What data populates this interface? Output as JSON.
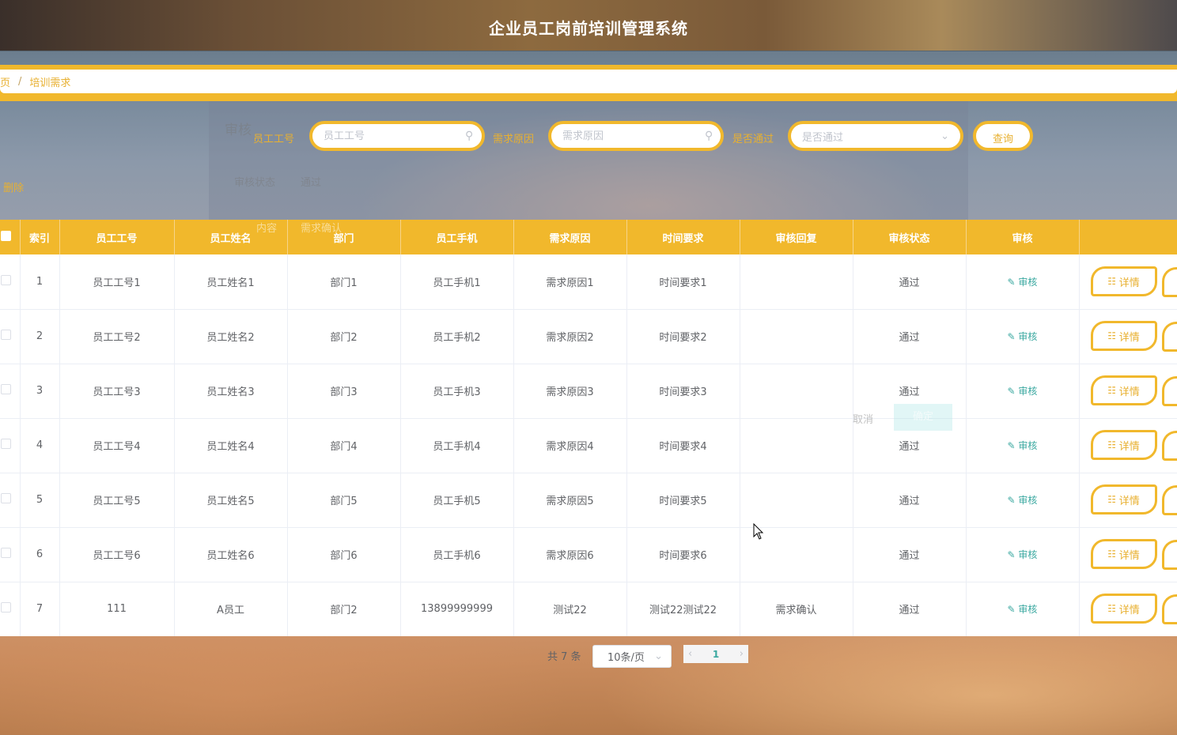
{
  "app": {
    "title": "企业员工岗前培训管理系统"
  },
  "breadcrumb": {
    "home": "页",
    "separator": "/",
    "current": "培训需求"
  },
  "ghost_dialog": {
    "title": "审核",
    "status_label": "审核状态",
    "status_value": "通过",
    "content_label": "内容",
    "content_value": "需求确认",
    "cancel": "取消",
    "confirm": "确定"
  },
  "search": {
    "employee_id_label": "员工工号",
    "employee_id_placeholder": "员工工号",
    "reason_label": "需求原因",
    "reason_placeholder": "需求原因",
    "passed_label": "是否通过",
    "passed_placeholder": "是否通过",
    "query_button": "查询"
  },
  "toolbar": {
    "delete_label": "删除"
  },
  "table": {
    "columns": [
      "索引",
      "员工工号",
      "员工姓名",
      "部门",
      "员工手机",
      "需求原因",
      "时间要求",
      "审核回复",
      "审核状态",
      "审核"
    ],
    "audit_link": "审核",
    "detail_button": "详情",
    "rows": [
      {
        "index": "1",
        "emp_no": "员工工号1",
        "name": "员工姓名1",
        "dept": "部门1",
        "phone": "员工手机1",
        "reason": "需求原因1",
        "time": "时间要求1",
        "reply": "",
        "status": "通过"
      },
      {
        "index": "2",
        "emp_no": "员工工号2",
        "name": "员工姓名2",
        "dept": "部门2",
        "phone": "员工手机2",
        "reason": "需求原因2",
        "time": "时间要求2",
        "reply": "",
        "status": "通过"
      },
      {
        "index": "3",
        "emp_no": "员工工号3",
        "name": "员工姓名3",
        "dept": "部门3",
        "phone": "员工手机3",
        "reason": "需求原因3",
        "time": "时间要求3",
        "reply": "",
        "status": "通过"
      },
      {
        "index": "4",
        "emp_no": "员工工号4",
        "name": "员工姓名4",
        "dept": "部门4",
        "phone": "员工手机4",
        "reason": "需求原因4",
        "time": "时间要求4",
        "reply": "",
        "status": "通过"
      },
      {
        "index": "5",
        "emp_no": "员工工号5",
        "name": "员工姓名5",
        "dept": "部门5",
        "phone": "员工手机5",
        "reason": "需求原因5",
        "time": "时间要求5",
        "reply": "",
        "status": "通过"
      },
      {
        "index": "6",
        "emp_no": "员工工号6",
        "name": "员工姓名6",
        "dept": "部门6",
        "phone": "员工手机6",
        "reason": "需求原因6",
        "time": "时间要求6",
        "reply": "",
        "status": "通过"
      },
      {
        "index": "7",
        "emp_no": "111",
        "name": "A员工",
        "dept": "部门2",
        "phone": "13899999999",
        "reason": "测试22",
        "time": "测试22测试22",
        "reply": "需求确认",
        "status": "通过"
      }
    ]
  },
  "pagination": {
    "total_text": "共 7 条",
    "page_size": "10条/页",
    "current_page": "1"
  },
  "colors": {
    "accent": "#f1b82c",
    "accent_text": "#e8b030",
    "link": "#3aa8a0"
  }
}
